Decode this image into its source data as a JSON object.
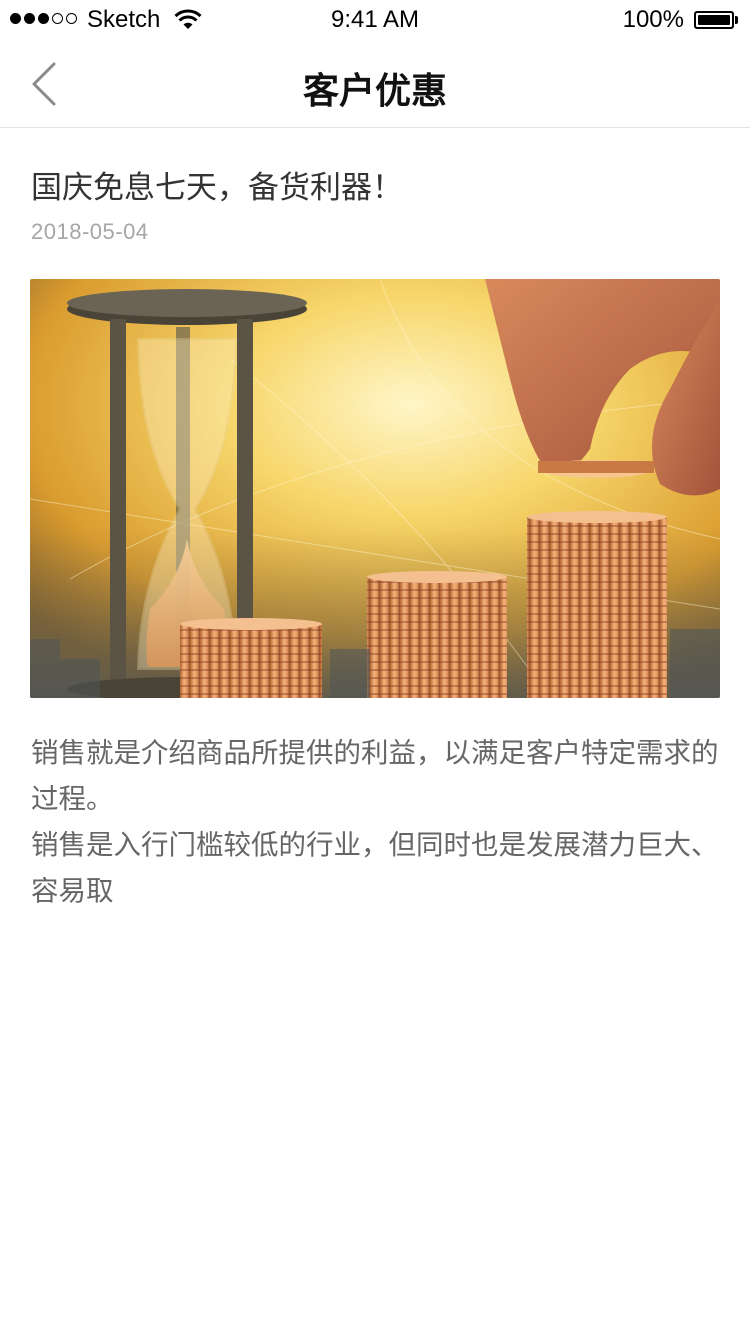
{
  "status_bar": {
    "carrier": "Sketch",
    "time": "9:41 AM",
    "battery": "100%",
    "signal_bars_filled": 3,
    "signal_bars_total": 5
  },
  "nav": {
    "title": "客户优惠",
    "back_icon": "chevron-left-icon"
  },
  "article": {
    "title": "国庆免息七天，备货利器！",
    "date": "2018-05-04",
    "image_subject": "hourglass-and-coin-stacks",
    "paragraphs": [
      "销售就是介绍商品所提供的利益，以满足客户特定需求的过程。",
      "销售是入行门槛较低的行业，但同时也是发展潜力巨大、容易取"
    ]
  },
  "colors": {
    "title_text": "#333333",
    "date_text": "#a6a6a6",
    "body_text": "#666666",
    "divider": "#e2e2e2",
    "image_gold": "#f3c24a"
  }
}
